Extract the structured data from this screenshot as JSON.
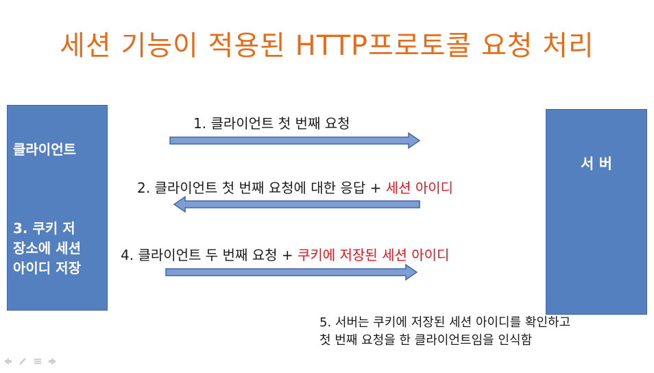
{
  "title": "세션 기능이 적용된 HTTP프로토콜 요청 처리",
  "client": {
    "label": "클라이언트",
    "note_line1": "3. 쿠키 저",
    "note_line2": "장소에 세션",
    "note_line3": "아이디 저장"
  },
  "server": {
    "label": "서  버"
  },
  "messages": [
    {
      "text": "1. 클라이언트 첫 번째 요청",
      "direction": "to-server"
    },
    {
      "text": "2. 클라이언트 첫 번째 요청에 대한 응답 + ",
      "highlight": "세션 아이디",
      "direction": "to-client"
    },
    {
      "text": "4. 클라이언트 두 번째 요청 + ",
      "highlight": "쿠키에 저장된 세션 아이디",
      "direction": "to-server"
    }
  ],
  "final_note": {
    "line1": "5. 서버는 쿠키에 저장된 세션 아이디를 확인하고",
    "line2": "첫 번째 요청을 한 클라이언트임을 인식함"
  },
  "colors": {
    "title": "#E46C1A",
    "box_fill": "#5580C0",
    "arrow_fill": "#7E9ED3",
    "arrow_stroke": "#3F66A3",
    "highlight": "#E8141E"
  },
  "icons": [
    "prev-slide-icon",
    "pen-icon",
    "menu-icon",
    "next-slide-icon"
  ]
}
